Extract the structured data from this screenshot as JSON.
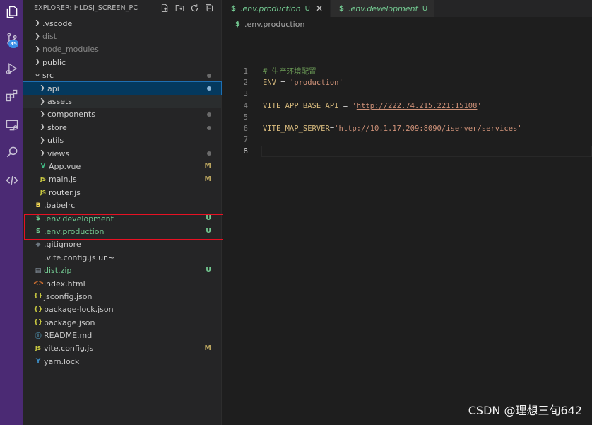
{
  "explorer": {
    "title": "EXPLORER: HLDSJ_SCREEN_PC",
    "scm_badge": "35"
  },
  "tree": [
    {
      "label": ".vscode",
      "type": "folder",
      "collapsed": true,
      "indent": 0
    },
    {
      "label": "dist",
      "type": "folder",
      "collapsed": true,
      "indent": 0,
      "dim": true
    },
    {
      "label": "node_modules",
      "type": "folder",
      "collapsed": true,
      "indent": 0,
      "dim": true
    },
    {
      "label": "public",
      "type": "folder",
      "collapsed": true,
      "indent": 0
    },
    {
      "label": "src",
      "type": "folder",
      "collapsed": false,
      "indent": 0,
      "dot": true
    },
    {
      "label": "api",
      "type": "folder",
      "collapsed": true,
      "indent": 1,
      "active": true,
      "dot": true
    },
    {
      "label": "assets",
      "type": "folder",
      "collapsed": true,
      "indent": 1,
      "hover": true
    },
    {
      "label": "components",
      "type": "folder",
      "collapsed": true,
      "indent": 1,
      "dot": true
    },
    {
      "label": "store",
      "type": "folder",
      "collapsed": true,
      "indent": 1,
      "dot": true
    },
    {
      "label": "utils",
      "type": "folder",
      "collapsed": true,
      "indent": 1
    },
    {
      "label": "views",
      "type": "folder",
      "collapsed": true,
      "indent": 1,
      "dot": true
    },
    {
      "label": "App.vue",
      "type": "vue",
      "indent": 1,
      "status": "M"
    },
    {
      "label": "main.js",
      "type": "js",
      "indent": 1,
      "status": "M"
    },
    {
      "label": "router.js",
      "type": "js",
      "indent": 1
    },
    {
      "label": ".babelrc",
      "type": "babel",
      "indent": 0
    },
    {
      "label": ".env.development",
      "type": "env",
      "indent": 0,
      "status": "U"
    },
    {
      "label": ".env.production",
      "type": "env",
      "indent": 0,
      "status": "U"
    },
    {
      "label": ".gitignore",
      "type": "git",
      "indent": 0
    },
    {
      "label": ".vite.config.js.un~",
      "type": "file",
      "indent": 0
    },
    {
      "label": "dist.zip",
      "type": "zip",
      "indent": 0,
      "status": "U"
    },
    {
      "label": "index.html",
      "type": "html",
      "indent": 0
    },
    {
      "label": "jsconfig.json",
      "type": "json",
      "indent": 0
    },
    {
      "label": "package-lock.json",
      "type": "json",
      "indent": 0
    },
    {
      "label": "package.json",
      "type": "json",
      "indent": 0
    },
    {
      "label": "README.md",
      "type": "info",
      "indent": 0
    },
    {
      "label": "vite.config.js",
      "type": "js",
      "indent": 0,
      "status": "M"
    },
    {
      "label": "yarn.lock",
      "type": "yarn",
      "indent": 0
    }
  ],
  "tabs": [
    {
      "label": ".env.production",
      "status": "U",
      "active": true
    },
    {
      "label": ".env.development",
      "status": "U",
      "active": false
    }
  ],
  "breadcrumb": ".env.production",
  "code": {
    "current_line": 8,
    "lines": [
      {
        "n": "1",
        "parts": [
          {
            "t": "# 生产环境配置",
            "c": "comment"
          }
        ]
      },
      {
        "n": "2",
        "parts": [
          {
            "t": "ENV",
            "c": "key"
          },
          {
            "t": " = ",
            "c": "eq"
          },
          {
            "t": "'production'",
            "c": "str"
          }
        ]
      },
      {
        "n": "3",
        "parts": []
      },
      {
        "n": "4",
        "parts": [
          {
            "t": "VITE_APP_BASE_API",
            "c": "key"
          },
          {
            "t": " = ",
            "c": "eq"
          },
          {
            "t": "'",
            "c": "str"
          },
          {
            "t": "http://222.74.215.221:15108",
            "c": "str url"
          },
          {
            "t": "'",
            "c": "str"
          }
        ]
      },
      {
        "n": "5",
        "parts": []
      },
      {
        "n": "6",
        "parts": [
          {
            "t": "VITE_MAP_SERVER",
            "c": "key"
          },
          {
            "t": "=",
            "c": "eq"
          },
          {
            "t": "'",
            "c": "str"
          },
          {
            "t": "http://10.1.17.209:8090/iserver/services",
            "c": "str url"
          },
          {
            "t": "'",
            "c": "str"
          }
        ]
      },
      {
        "n": "7",
        "parts": []
      },
      {
        "n": "8",
        "parts": []
      }
    ]
  },
  "watermark": "CSDN @理想三旬642",
  "colors": {
    "activity_bar": "#4b2a74",
    "untracked": "#73c991",
    "modified": "#b8a35e",
    "highlight_box": "#e81123"
  }
}
